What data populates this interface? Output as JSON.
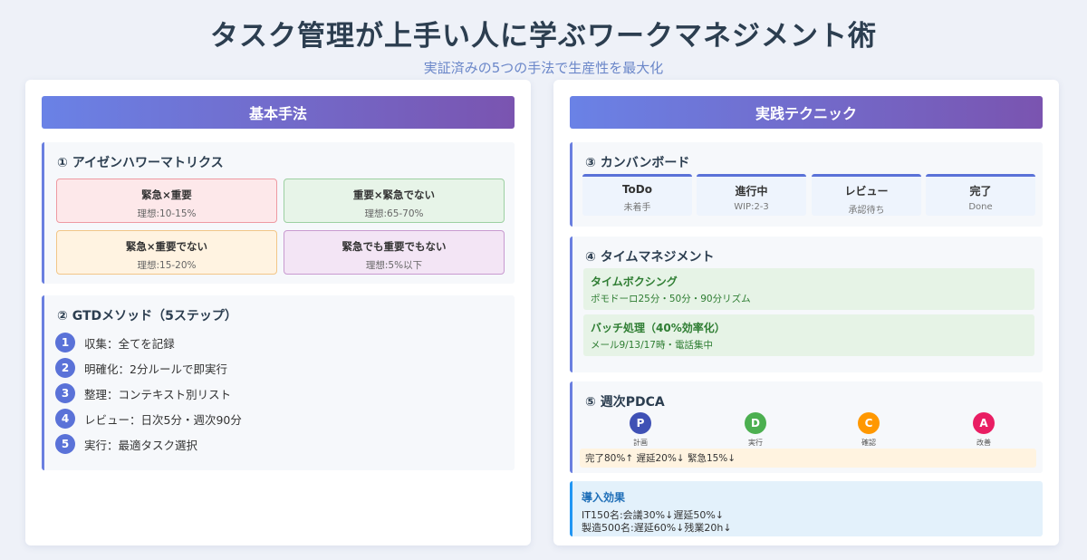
{
  "title": "タスク管理が上手い人に学ぶワークマネジメント術",
  "subtitle": "実証済みの5つの手法で生産性を最大化",
  "left_panel": {
    "header": "基本手法",
    "eisenhower": {
      "title": "① アイゼンハワーマトリクス",
      "quadrants": [
        {
          "title": "緊急×重要",
          "sub": "理想:10-15%"
        },
        {
          "title": "重要×緊急でない",
          "sub": "理想:65-70%"
        },
        {
          "title": "緊急×重要でない",
          "sub": "理想:15-20%"
        },
        {
          "title": "緊急でも重要でもない",
          "sub": "理想:5%以下"
        }
      ]
    },
    "gtd": {
      "title": "② GTDメソッド（5ステップ）",
      "steps": [
        {
          "num": "1",
          "text": "収集：全てを記録"
        },
        {
          "num": "2",
          "text": "明確化：2分ルールで即実行"
        },
        {
          "num": "3",
          "text": "整理：コンテキスト別リスト"
        },
        {
          "num": "4",
          "text": "レビュー：日次5分・週次90分"
        },
        {
          "num": "5",
          "text": "実行：最適タスク選択"
        }
      ]
    }
  },
  "right_panel": {
    "header": "実践テクニック",
    "kanban": {
      "title": "③ カンバンボード",
      "columns": [
        {
          "title": "ToDo",
          "sub": "未着手"
        },
        {
          "title": "進行中",
          "sub": "WIP:2-3"
        },
        {
          "title": "レビュー",
          "sub": "承認待ち"
        },
        {
          "title": "完了",
          "sub": "Done"
        }
      ]
    },
    "time": {
      "title": "④ タイムマネジメント",
      "items": [
        {
          "title": "タイムボクシング",
          "sub": "ポモドーロ25分・50分・90分リズム"
        },
        {
          "title": "バッチ処理（40%効率化）",
          "sub": "メール9/13/17時・電話集中"
        }
      ]
    },
    "pdca": {
      "title": "⑤ 週次PDCA",
      "steps": [
        {
          "letter": "P",
          "label": "計画",
          "color": "#3f51b5"
        },
        {
          "letter": "D",
          "label": "実行",
          "color": "#4caf50"
        },
        {
          "letter": "C",
          "label": "確認",
          "color": "#ff9800"
        },
        {
          "letter": "A",
          "label": "改善",
          "color": "#e91e63"
        }
      ],
      "result": "完了80%↑ 遅延20%↓ 緊急15%↓"
    },
    "impact": {
      "title": "導入効果",
      "lines": [
        "IT150名:会議30%↓遅延50%↓",
        "製造500名:遅延60%↓残業20h↓"
      ]
    }
  }
}
